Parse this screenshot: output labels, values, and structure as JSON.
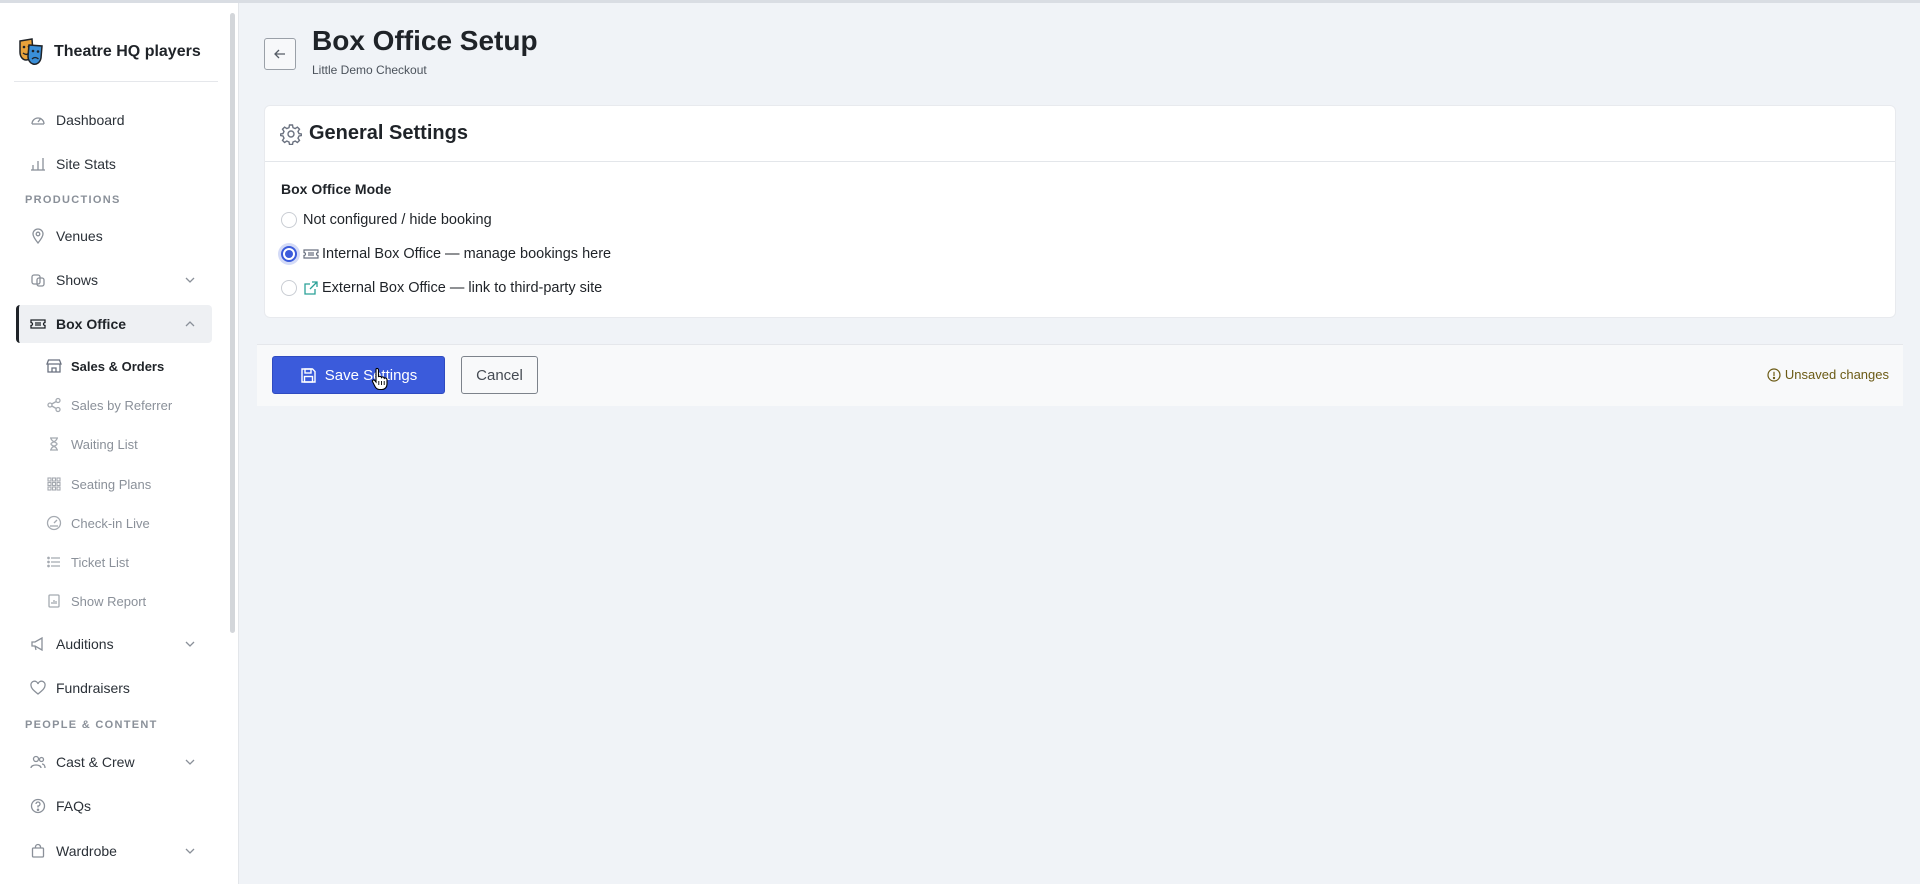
{
  "sidebar": {
    "brand": "Theatre HQ players",
    "items": {
      "dashboard": "Dashboard",
      "site_stats": "Site Stats",
      "productions_label": "PRODUCTIONS",
      "venues": "Venues",
      "shows": "Shows",
      "box_office": "Box Office",
      "auditions": "Auditions",
      "fundraisers": "Fundraisers",
      "people_label": "PEOPLE & CONTENT",
      "cast_crew": "Cast & Crew",
      "faqs": "FAQs",
      "wardrobe": "Wardrobe"
    },
    "box_office_sub": [
      {
        "label": "Sales & Orders",
        "icon": "store-icon"
      },
      {
        "label": "Sales by Referrer",
        "icon": "share-icon"
      },
      {
        "label": "Waiting List",
        "icon": "hourglass-icon"
      },
      {
        "label": "Seating Plans",
        "icon": "grid-icon"
      },
      {
        "label": "Check-in Live",
        "icon": "gauge-icon"
      },
      {
        "label": "Ticket List",
        "icon": "list-icon"
      },
      {
        "label": "Show Report",
        "icon": "report-icon"
      }
    ]
  },
  "header": {
    "title": "Box Office Setup",
    "subtitle": "Little Demo Checkout"
  },
  "settings": {
    "card_title": "General Settings",
    "mode_label": "Box Office Mode",
    "options": [
      {
        "label": "Not configured / hide booking",
        "checked": false
      },
      {
        "label": "Internal Box Office — manage bookings here",
        "checked": true
      },
      {
        "label": "External Box Office — link to third-party site",
        "checked": false
      }
    ]
  },
  "actions": {
    "save_label": "Save Settings",
    "cancel_label": "Cancel",
    "status": "Unsaved changes"
  },
  "colors": {
    "accent": "#3b5bdb",
    "status": "#6b5a14",
    "external_icon": "#2aa198"
  }
}
